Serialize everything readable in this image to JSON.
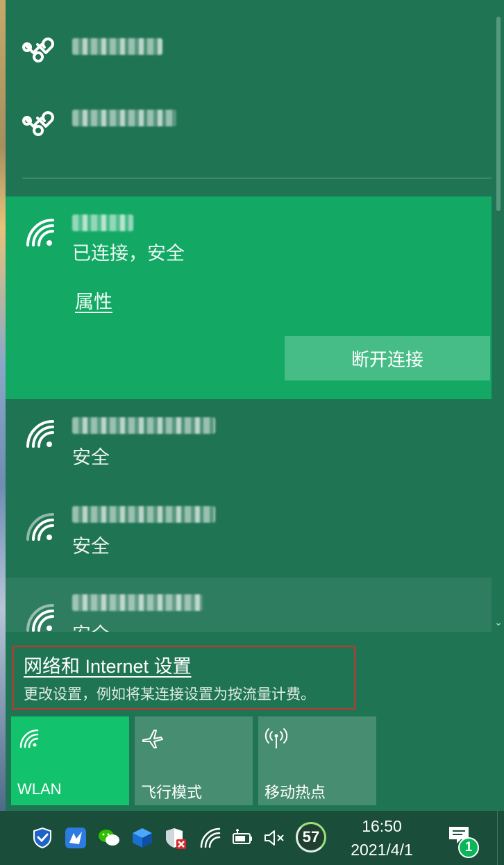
{
  "networks": {
    "hotspots": [
      {
        "icon": "mobile-hotspot-icon"
      },
      {
        "icon": "mobile-hotspot-icon"
      }
    ],
    "connected": {
      "status": "已连接，安全",
      "properties_label": "属性",
      "disconnect_label": "断开连接"
    },
    "others": [
      {
        "status": "安全"
      },
      {
        "status": "安全"
      },
      {
        "status": "安全"
      }
    ]
  },
  "settings": {
    "title": "网络和 Internet 设置",
    "description": "更改设置，例如将某连接设置为按流量计费。"
  },
  "quick_actions": [
    {
      "label": "WLAN",
      "icon": "wifi-icon",
      "active": true
    },
    {
      "label": "飞行模式",
      "icon": "airplane-icon",
      "active": false
    },
    {
      "label": "移动热点",
      "icon": "hotspot-icon",
      "active": false
    }
  ],
  "taskbar": {
    "battery_level": "57",
    "time": "16:50",
    "date": "2021/4/1",
    "notification_count": "1"
  },
  "colors": {
    "flyout_bg": "#1f7454",
    "connected_bg": "#13a965",
    "tile_active": "#13c26c",
    "highlight_border": "#c5362f"
  }
}
